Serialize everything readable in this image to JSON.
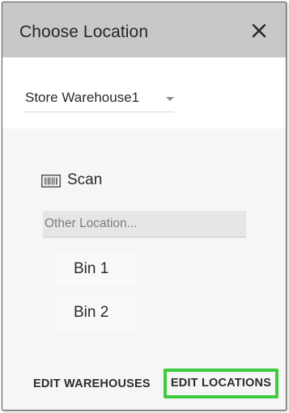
{
  "dialog": {
    "title": "Choose Location",
    "close_icon": "close-icon"
  },
  "warehouse_select": {
    "selected": "Store Warehouse1",
    "icon": "dropdown-arrow-icon"
  },
  "scan": {
    "label": "Scan",
    "icon": "barcode-icon"
  },
  "other_location": {
    "placeholder": "Other Location...",
    "value": ""
  },
  "bins": [
    {
      "label": "Bin 1"
    },
    {
      "label": "Bin 2"
    }
  ],
  "actions": {
    "edit_warehouses": "EDIT WAREHOUSES",
    "edit_locations": "EDIT LOCATIONS"
  },
  "colors": {
    "header_bg": "#c8c8c8",
    "body_bg": "#f6f6f6",
    "highlight": "#3ecb3e"
  }
}
